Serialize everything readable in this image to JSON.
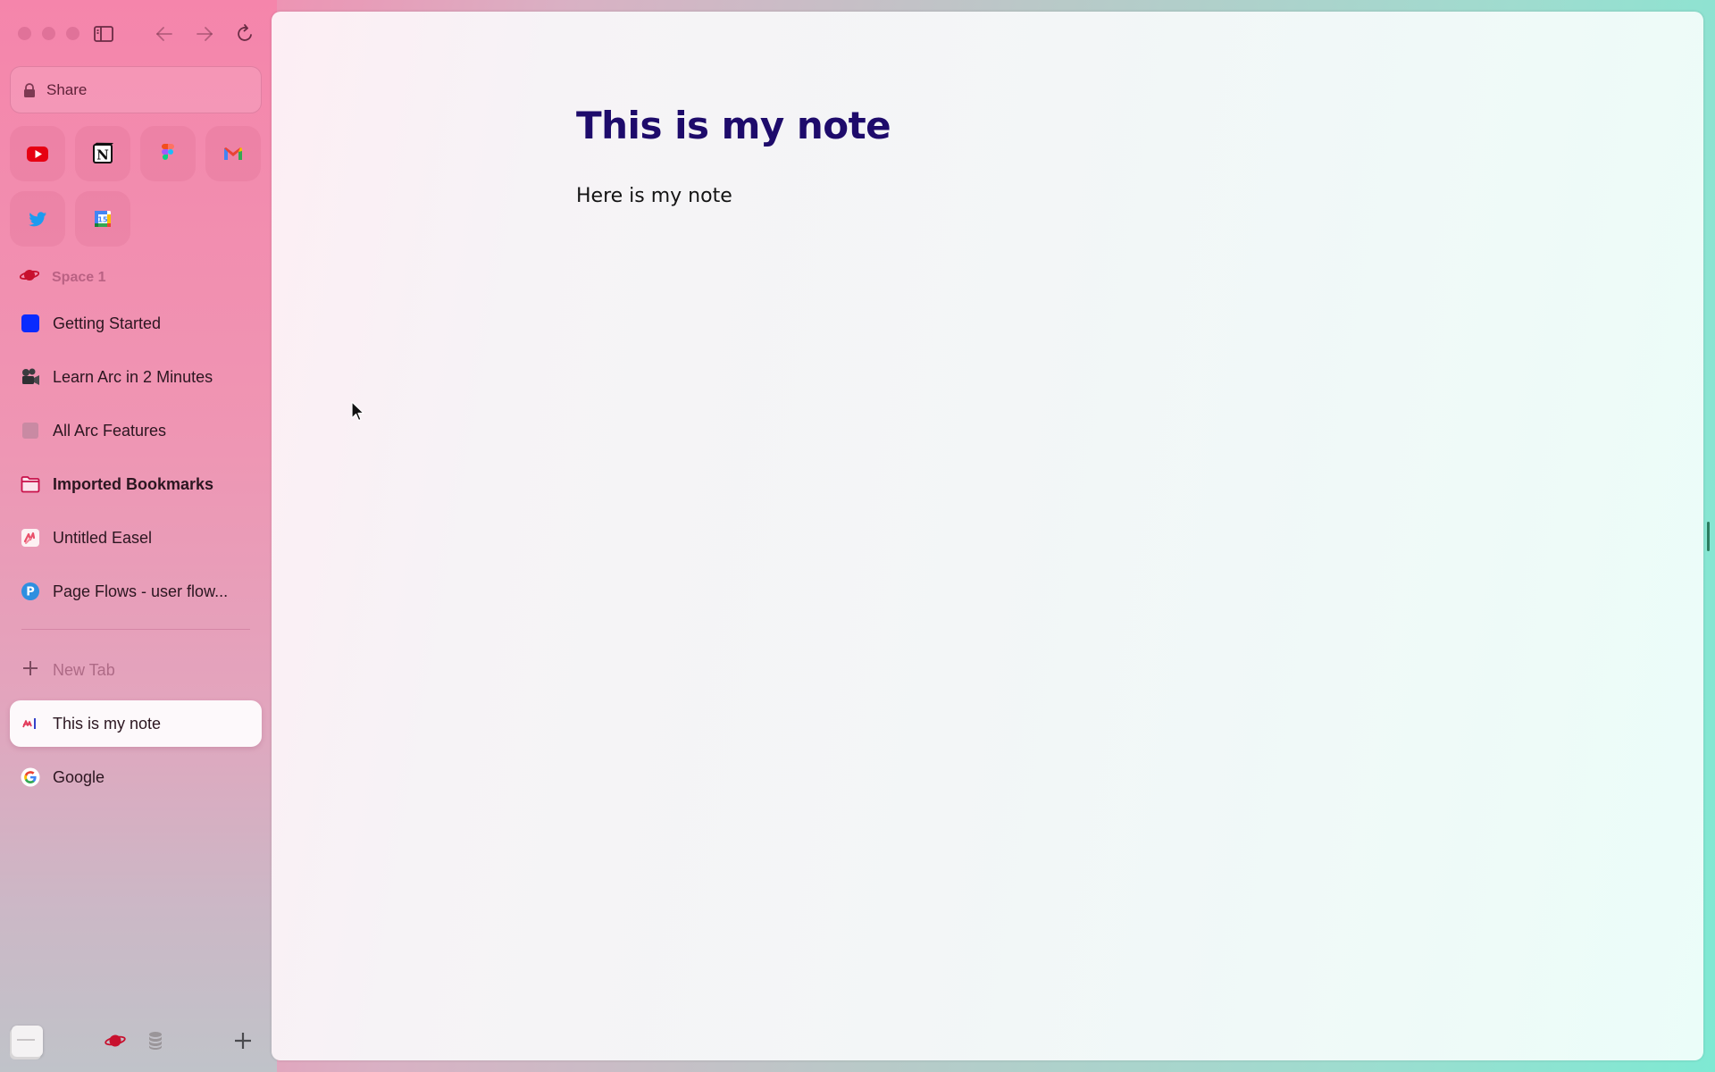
{
  "window": {
    "controls": [
      "close",
      "minimize",
      "zoom"
    ]
  },
  "toolbar": {
    "sidebar_toggle_icon": "sidebar-icon",
    "back_icon": "arrow-left-icon",
    "forward_icon": "arrow-right-icon",
    "reload_icon": "reload-icon"
  },
  "urlbar": {
    "icon": "lock-icon",
    "label": "Share"
  },
  "favorites": [
    {
      "name": "YouTube",
      "icon": "youtube-icon"
    },
    {
      "name": "Notion",
      "icon": "notion-icon"
    },
    {
      "name": "Figma",
      "icon": "figma-icon"
    },
    {
      "name": "Gmail",
      "icon": "gmail-icon"
    },
    {
      "name": "Twitter",
      "icon": "twitter-icon"
    },
    {
      "name": "Google Calendar",
      "icon": "calendar-icon",
      "badge": "15"
    }
  ],
  "space": {
    "label": "Space 1",
    "icon": "planet-icon",
    "accent": "#c8102e"
  },
  "pinned_tabs": [
    {
      "title": "Getting Started",
      "icon": "blue-square-icon"
    },
    {
      "title": "Learn Arc in 2 Minutes",
      "icon": "movie-camera-icon"
    },
    {
      "title": "All Arc Features",
      "icon": "gray-square-icon"
    },
    {
      "title": "Imported Bookmarks",
      "icon": "folder-icon"
    },
    {
      "title": "Untitled Easel",
      "icon": "easel-icon"
    },
    {
      "title": "Page Flows - user flow...",
      "icon": "pageflows-icon"
    }
  ],
  "new_tab": {
    "label": "New Tab"
  },
  "tabs": [
    {
      "title": "This is my note",
      "icon": "note-icon",
      "active": true
    },
    {
      "title": "Google",
      "icon": "google-icon",
      "active": false
    }
  ],
  "bottom_bar": {
    "library_icon": "library-icon",
    "space_icon": "planet-icon",
    "archive_icon": "database-icon",
    "add_icon": "plus-icon"
  },
  "page": {
    "title": "This is my note",
    "body": "Here is my note",
    "title_color": "#1e0b6b"
  }
}
